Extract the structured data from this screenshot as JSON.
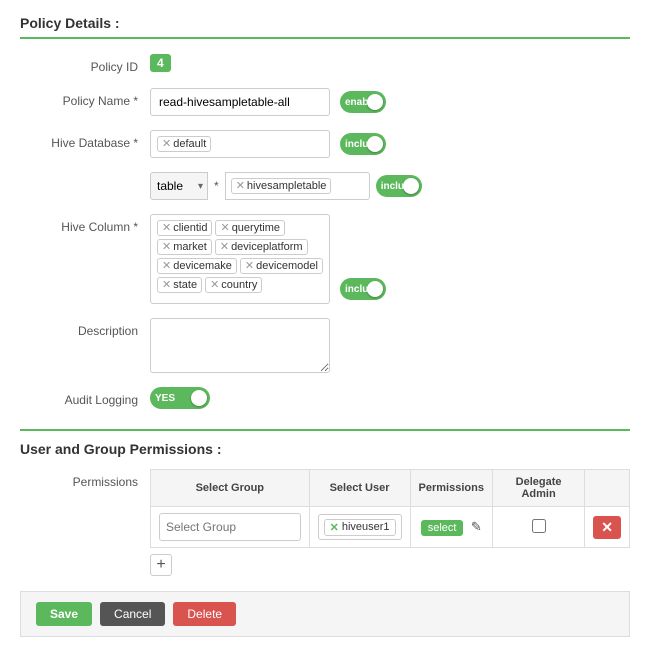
{
  "page": {
    "policy_details_title": "Policy Details :",
    "user_group_title": "User and Group Permissions :"
  },
  "policy": {
    "id": "4",
    "name": "read-hivesampletable-all",
    "enabled_label": "enabled",
    "hive_database": "default",
    "database_include_label": "include",
    "table_dropdown_value": "table",
    "table_value": "hivesampletable",
    "table_include_label": "include",
    "hive_columns": [
      "clientid",
      "querytime",
      "market",
      "deviceplatform",
      "devicemake",
      "devicemodel",
      "state",
      "country"
    ],
    "column_include_label": "include",
    "description_placeholder": "",
    "audit_logging_label": "YES"
  },
  "labels": {
    "policy_id": "Policy ID",
    "policy_name": "Policy Name *",
    "hive_database": "Hive Database *",
    "hive_table_label": "* ",
    "hive_column": "Hive Column *",
    "description": "Description",
    "audit_logging": "Audit Logging",
    "permissions": "Permissions"
  },
  "permissions_table": {
    "col_select_group": "Select Group",
    "col_select_user": "Select User",
    "col_permissions": "Permissions",
    "col_delegate_admin": "Delegate Admin",
    "rows": [
      {
        "group_placeholder": "Select Group",
        "user": "hiveuser1",
        "permissions_btn": "select",
        "delegate": false
      }
    ]
  },
  "buttons": {
    "save": "Save",
    "cancel": "Cancel",
    "delete": "Delete",
    "add_row": "+",
    "delete_row": "✕"
  }
}
